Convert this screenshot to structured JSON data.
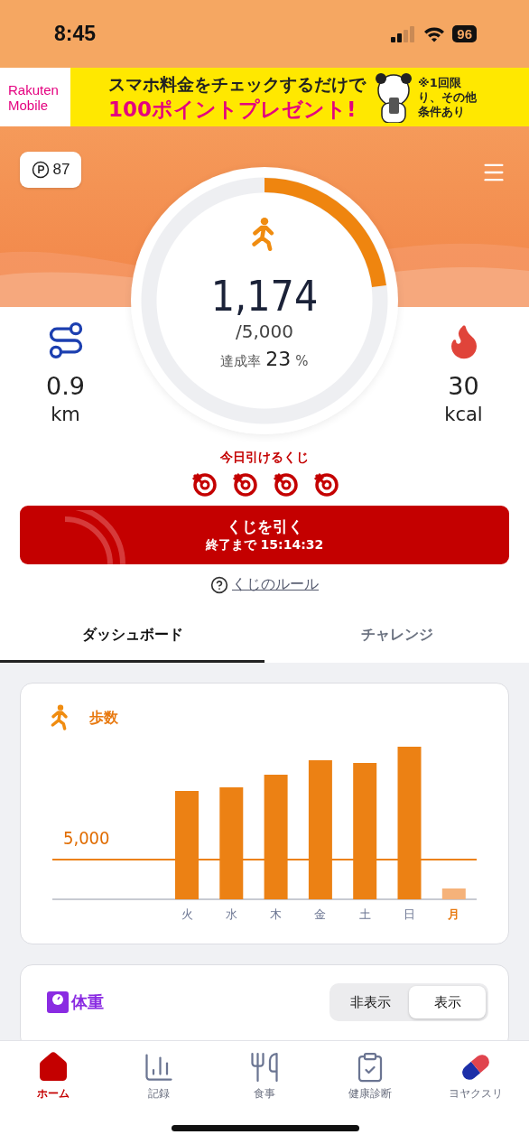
{
  "status_bar": {
    "time": "8:45",
    "battery": "96"
  },
  "ad_banner": {
    "logo_top": "Rakuten",
    "logo_bottom": "Mobile",
    "headline": "スマホ料金をチェックするだけで",
    "offer": "100ポイントプレゼント!",
    "note": "※1回限り、その他条件あり"
  },
  "points": {
    "value": "87"
  },
  "steps": {
    "count": "1,174",
    "goal": "/5,000",
    "rate_label": "達成率",
    "rate": "23",
    "rate_unit": "%",
    "level": 0.23
  },
  "distance": {
    "value": "0.9",
    "unit": "km"
  },
  "calories": {
    "value": "30",
    "unit": "kcal"
  },
  "lottery": {
    "title": "今日引けるくじ",
    "tickets": [
      {
        "kind": "ticket"
      },
      {
        "kind": "ticket"
      },
      {
        "kind": "ticket"
      },
      {
        "kind": "ticket"
      }
    ],
    "button_label": "くじを引く",
    "countdown": "終了まで 15:14:32",
    "rules_link": "くじのルール"
  },
  "tabs": [
    {
      "label": "ダッシュボード",
      "selected": true
    },
    {
      "label": "チャレンジ",
      "selected": false
    }
  ],
  "steps_card": {
    "title": "歩数",
    "goal_label": "5,000",
    "days": [
      {
        "label": "火",
        "selected": false
      },
      {
        "label": "水",
        "selected": false
      },
      {
        "label": "木",
        "selected": false
      },
      {
        "label": "金",
        "selected": false
      },
      {
        "label": "土",
        "selected": false
      },
      {
        "label": "日",
        "selected": false
      },
      {
        "label": "月",
        "selected": true
      }
    ]
  },
  "weight_card": {
    "title": "体重",
    "toggle": [
      {
        "label": "非表示",
        "selected": false
      },
      {
        "label": "表示",
        "selected": true
      }
    ]
  },
  "bottom_nav": [
    {
      "label": "ホーム",
      "kind": "home",
      "selected": true
    },
    {
      "label": "記録",
      "kind": "records",
      "selected": false
    },
    {
      "label": "食事",
      "kind": "meal",
      "selected": false
    },
    {
      "label": "健康診断",
      "kind": "checkup",
      "selected": false
    },
    {
      "label": "ヨヤクスリ",
      "kind": "pill",
      "selected": false
    }
  ]
}
